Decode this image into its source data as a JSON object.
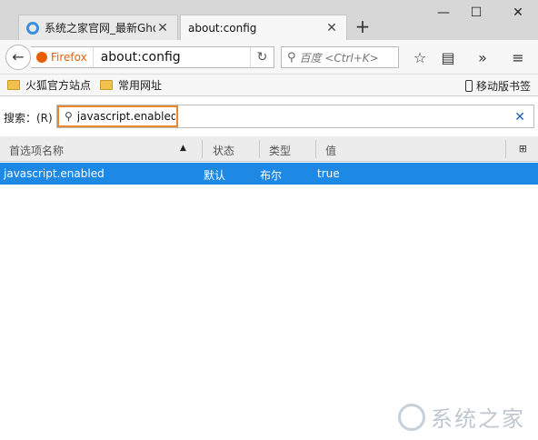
{
  "tabs": [
    {
      "label": "系统之家官网_最新Gho",
      "active": false
    },
    {
      "label": "about:config",
      "active": true
    }
  ],
  "window_controls": {
    "minimize": "—",
    "maximize": "☐",
    "close": "✕"
  },
  "navbar": {
    "identity_label": "Firefox",
    "url": "about:config",
    "search_placeholder": "百度 <Ctrl+K>"
  },
  "bookmarks": {
    "items": [
      {
        "label": "火狐官方站点"
      },
      {
        "label": "常用网址"
      }
    ],
    "mobile_label": "移动版书签"
  },
  "config_search": {
    "label": "搜索：(R)",
    "value": "javascript.enabled"
  },
  "table": {
    "headers": {
      "name": "首选项名称",
      "status": "状态",
      "type": "类型",
      "value": "值"
    },
    "rows": [
      {
        "name": "javascript.enabled",
        "status": "默认",
        "type": "布尔",
        "value": "true"
      }
    ]
  },
  "watermark": {
    "text": "系统之家"
  },
  "colors": {
    "selection": "#1e88e5",
    "highlight_border": "#e8892e",
    "brand": "#e66000"
  }
}
